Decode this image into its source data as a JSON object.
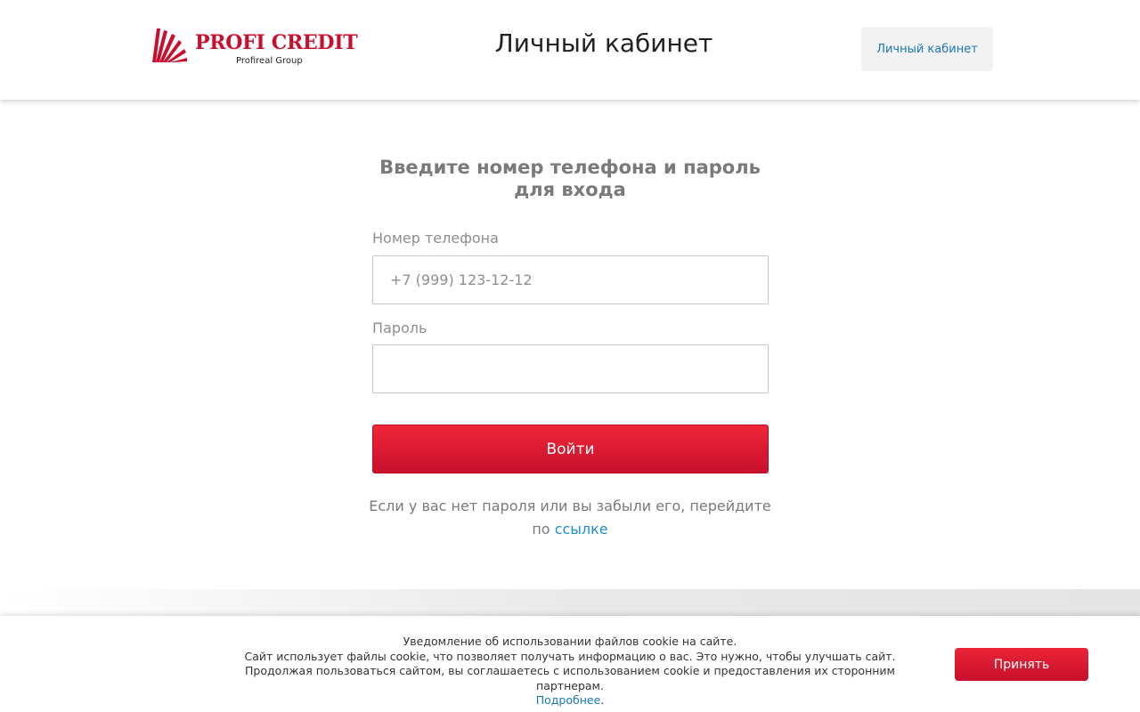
{
  "header": {
    "logo": {
      "brand": "PROFI CREDIT",
      "group": "Profireal Group",
      "icon": "sunburst-logo-icon"
    },
    "title": "Личный кабинет",
    "cabinet_button": "Личный кабинет"
  },
  "login": {
    "title": "Введите номер телефона и пароль для входа",
    "phone": {
      "label": "Номер телефона",
      "placeholder": "+7 (999) 123-12-12",
      "value": ""
    },
    "password": {
      "label": "Пароль",
      "value": ""
    },
    "submit": "Войти",
    "help_text": "Если у вас нет пароля или вы забыли его, перейдите по",
    "help_link": "ссылке"
  },
  "cookie": {
    "line1": "Уведомление об использовании файлов cookie на сайте.",
    "line2": "Сайт использует файлы cookie, что позволяет получать информацию о вас. Это нужно, чтобы улучшать сайт.",
    "line3": "Продолжая пользоваться сайтом, вы соглашаетесь с использованием cookie и предоставления их сторонним партнерам.",
    "more": "Подробнее",
    "accept": "Принять"
  },
  "colors": {
    "brand_red": "#c8102e",
    "link_blue": "#1a8fc9",
    "muted_text": "#7a7a7a"
  }
}
